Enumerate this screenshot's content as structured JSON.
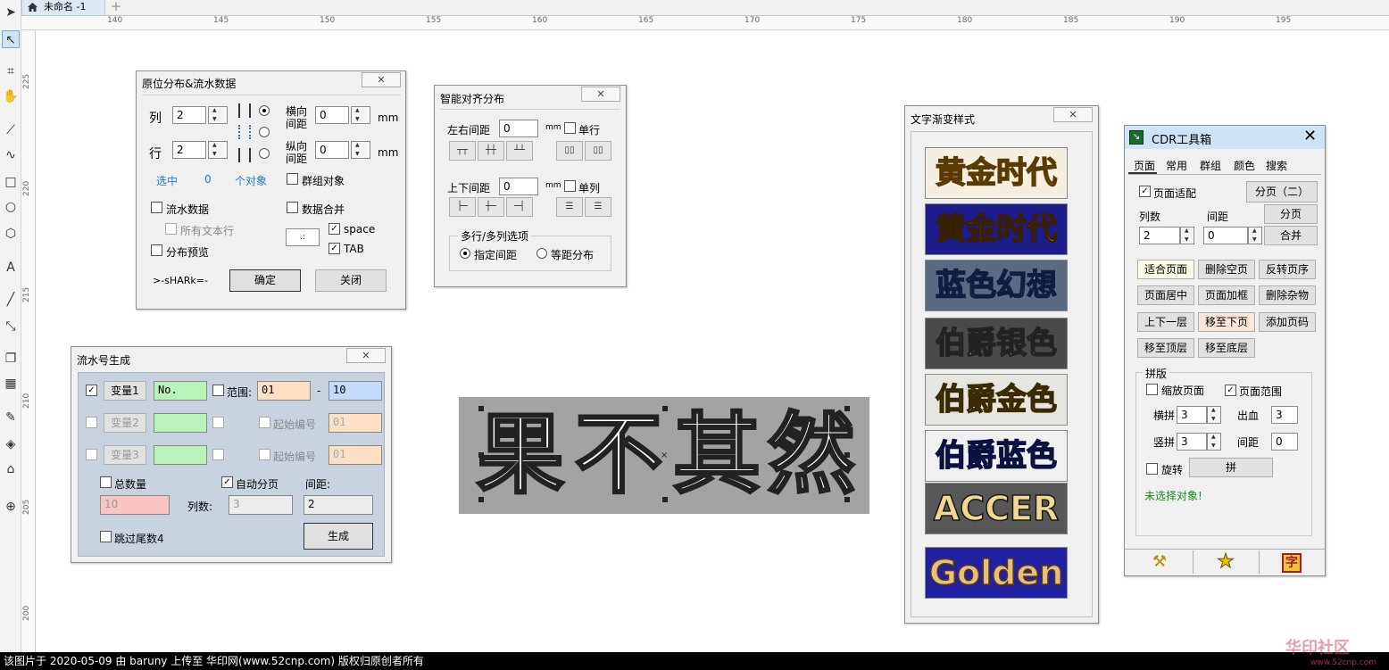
{
  "document": {
    "tab_title": "未命名 -1"
  },
  "ruler": {
    "h_labels": [
      "140",
      "145",
      "150",
      "155",
      "160",
      "165",
      "170",
      "175",
      "180",
      "185",
      "190",
      "195"
    ],
    "v_labels": [
      "225",
      "220",
      "215",
      "210",
      "205",
      "200"
    ]
  },
  "colors": {
    "toolbox_bg": "#f3f3f3",
    "dialog_bg": "#f0f0f0",
    "selected_tool": "#cfe3f7",
    "serial_panel_bg": "#c8d3df"
  },
  "toolbox_icons": [
    "pick-icon",
    "shape-icon",
    "crop-icon",
    "pan-icon",
    "freehand-icon",
    "curve-icon",
    "rectangle-icon",
    "ellipse-icon",
    "polygon-icon",
    "text-icon",
    "line-icon",
    "connector-icon",
    "shadow-icon",
    "transparency-icon",
    "eyedropper-icon",
    "fill-icon",
    "outline-icon",
    "add-icon"
  ],
  "dist_dialog": {
    "title": "原位分布&流水数据",
    "close": "✕",
    "col_label": "列",
    "col_value": "2",
    "row_label": "行",
    "row_value": "2",
    "h_gap_label1": "横向",
    "h_gap_label2": "间距",
    "h_gap_value": "0",
    "h_unit": "mm",
    "v_gap_label1": "纵向",
    "v_gap_label2": "间距",
    "v_gap_value": "0",
    "v_unit": "mm",
    "selected_label": "选中",
    "selected_count": "0",
    "objects_label": "个对象",
    "group_objects": "群组对象",
    "serial_data": "流水数据",
    "all_text_rows": "所有文本行",
    "merge_data": "数据合并",
    "sep_value": ".:",
    "space": "space",
    "tab": "TAB",
    "preview": "分布预览",
    "signature": ">-sHARk=-",
    "ok": "确定",
    "close_btn": "关闭"
  },
  "align_dialog": {
    "title": "智能对齐分布",
    "close": "✕",
    "lr_gap": "左右间距",
    "lr_value": "0",
    "lr_unit": "mm",
    "single_row": "单行",
    "tb_gap": "上下间距",
    "tb_value": "0",
    "tb_unit": "mm",
    "single_col": "单列",
    "multi_group": "多行/多列选项",
    "opt_specified": "指定间距",
    "opt_equal": "等距分布"
  },
  "serial_dialog": {
    "title": "流水号生成",
    "close": "✕",
    "var1": "变量1",
    "var1_value": "No.",
    "range": "范围:",
    "range_from": "01",
    "range_dash": "-",
    "range_to": "10",
    "var2": "变量2",
    "start_no1": "起始编号",
    "start_val1": "01",
    "var3": "变量3",
    "start_no2": "起始编号",
    "start_val2": "01",
    "total": "总数量",
    "auto_page": "自动分页",
    "gap": "间距:",
    "total_value": "10",
    "cols_label": "列数:",
    "cols_value": "3",
    "gap_value": "2",
    "skip_tail4": "跳过尾数4",
    "generate": "生成"
  },
  "canvas_text": {
    "chars": [
      "果",
      "不",
      "其",
      "然"
    ]
  },
  "gradient_panel": {
    "title": "文字渐变样式",
    "close": "✕",
    "styles": [
      {
        "text": "黄金时代",
        "bg": "#f4efe0",
        "fg": "#e0a020",
        "stroke": "#5a3a00"
      },
      {
        "text": "黄金时代",
        "bg": "#1c1c8c",
        "fg": "#f0c030",
        "stroke": "#3a2000"
      },
      {
        "text": "蓝色幻想",
        "bg": "#5a6a80",
        "fg": "#9cc2ee",
        "stroke": "#101c40"
      },
      {
        "text": "伯爵银色",
        "bg": "#4a4a4a",
        "fg": "#eeeeee",
        "stroke": "#222222"
      },
      {
        "text": "伯爵金色",
        "bg": "#e6e6e0",
        "fg": "#e8c040",
        "stroke": "#3a2a00"
      },
      {
        "text": "伯爵蓝色",
        "bg": "#f0f0f0",
        "fg": "#3a5ab8",
        "stroke": "#0a1040"
      },
      {
        "text": "ACCER",
        "bg": "#575757",
        "fg": "#f0d890",
        "stroke": "#1a1a1a"
      },
      {
        "text": "Golden",
        "bg": "#2020a0",
        "fg": "#e6c080",
        "stroke": "#5a3a10"
      }
    ]
  },
  "cdr_toolbox": {
    "title": "CDR工具箱",
    "close": "✕",
    "tabs": [
      "页面",
      "常用",
      "群组",
      "颜色",
      "搜索"
    ],
    "page_fit": "页面适配",
    "split2": "分页（二）",
    "cols_label": "列数",
    "gap_label": "间距",
    "split": "分页",
    "cols_value": "2",
    "gap_value": "0",
    "merge": "合并",
    "buttons_row1": [
      "适合页面",
      "删除空页",
      "反转页序"
    ],
    "buttons_row2": [
      "页面居中",
      "页面加框",
      "删除杂物"
    ],
    "buttons_row3": [
      "上下一层",
      "移至下页",
      "添加页码"
    ],
    "buttons_row4": [
      "移至顶层",
      "移至底层"
    ],
    "impose_group": "拼版",
    "scale_page": "缩放页面",
    "page_range": "页面范围",
    "h_label": "横拼",
    "h_value": "3",
    "bleed_label": "出血",
    "bleed_value": "3",
    "v_label": "竖拼",
    "v_value": "3",
    "spacing_label": "间距",
    "spacing_value": "0",
    "rotate": "旋转",
    "impose": "拼",
    "status": "未选择对象!",
    "bottom_icons": [
      "tools-icon",
      "star-icon",
      "character-icon"
    ],
    "char_glyph": "字"
  },
  "footer": {
    "text": "该图片于 2020-05-09 由 baruny 上传至 华印网(www.52cnp.com) 版权归原创者所有"
  },
  "watermark": {
    "text": "华印社区",
    "url": "www.52cnp.com"
  }
}
